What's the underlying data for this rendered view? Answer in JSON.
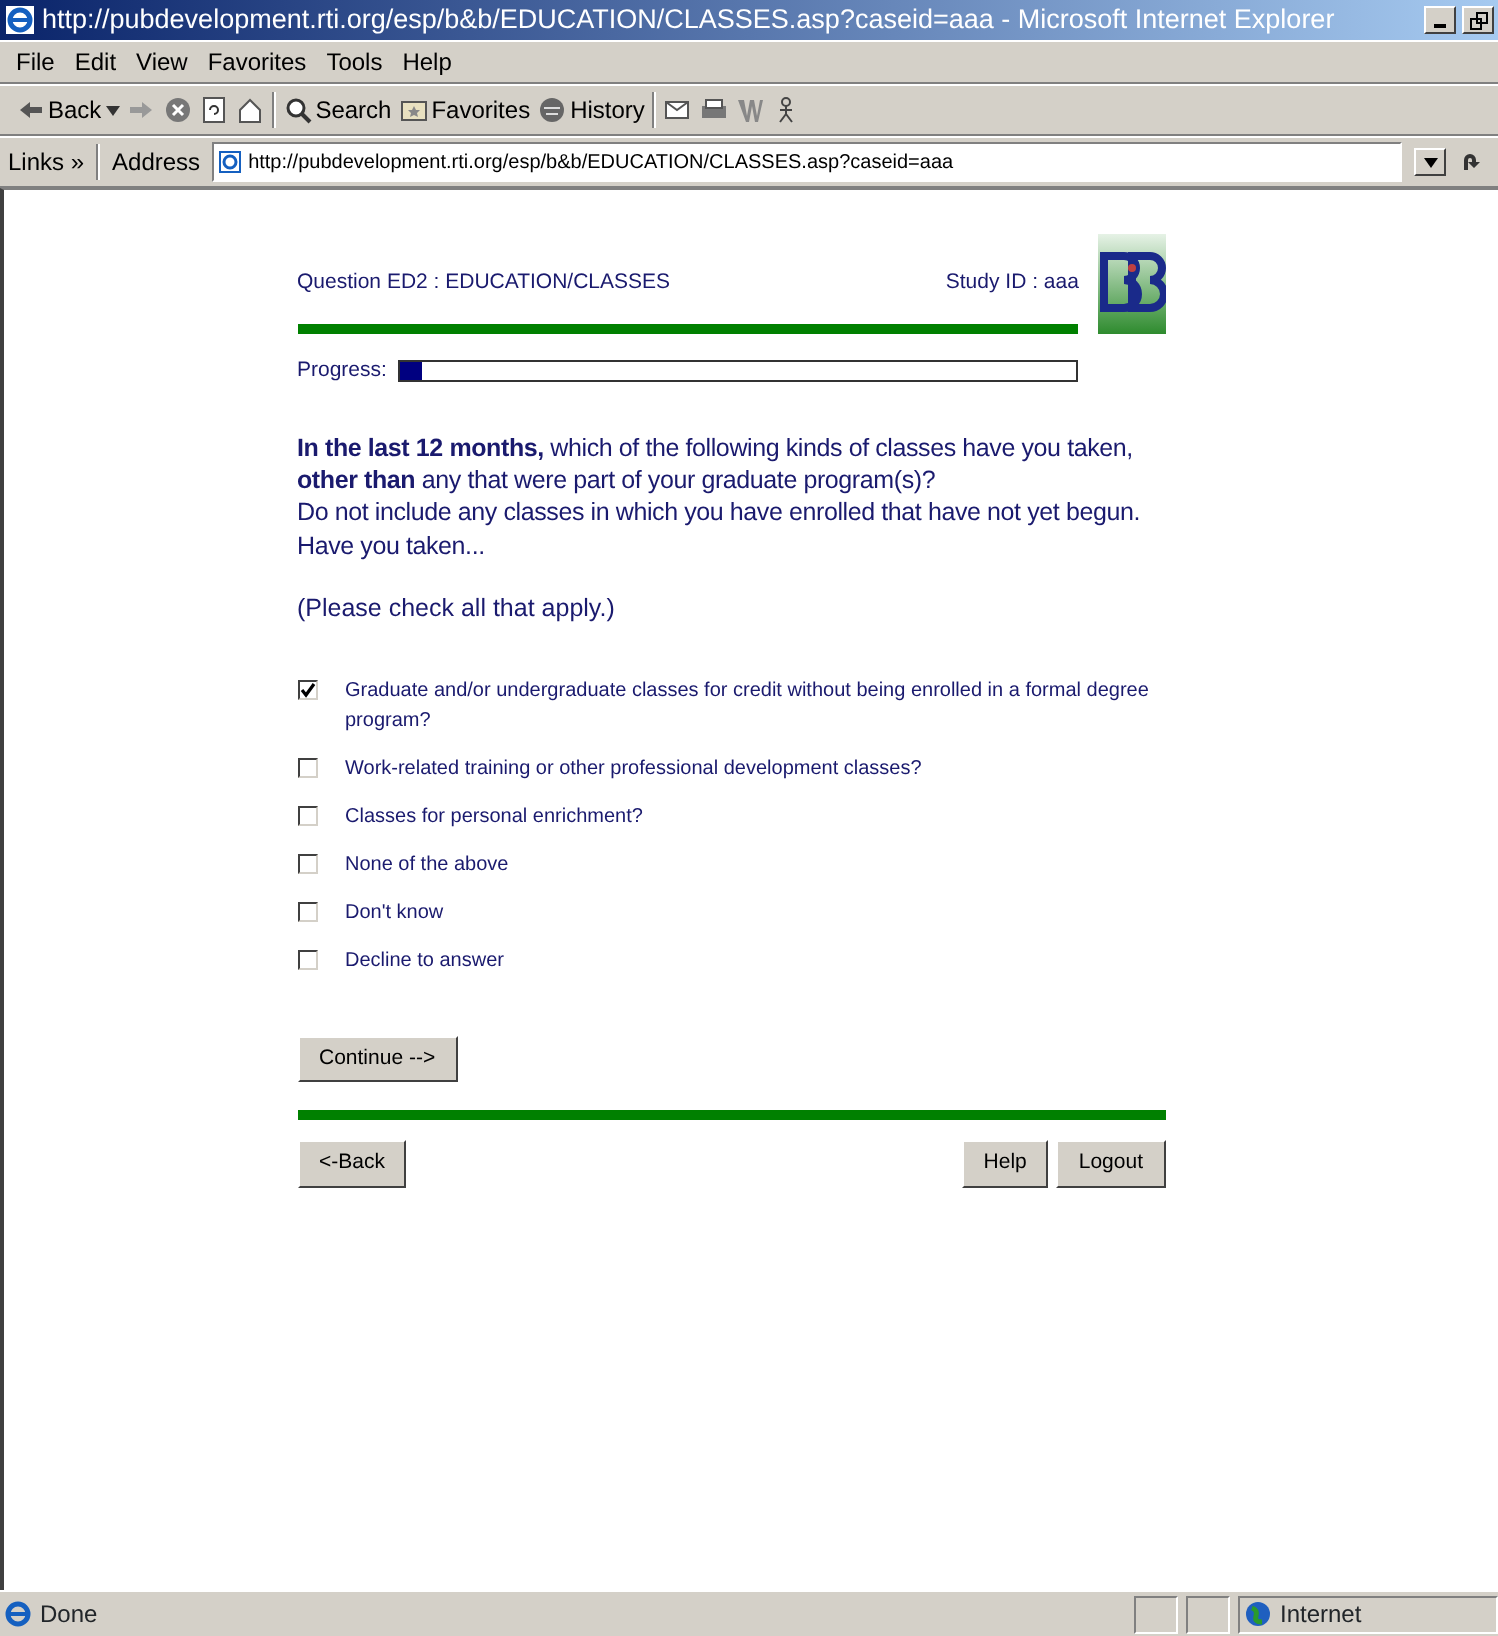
{
  "window": {
    "title": "http://pubdevelopment.rti.org/esp/b&b/EDUCATION/CLASSES.asp?caseid=aaa - Microsoft Internet Explorer"
  },
  "menu": [
    "File",
    "Edit",
    "View",
    "Favorites",
    "Tools",
    "Help"
  ],
  "toolbar": [
    {
      "kind": "back",
      "label": "Back"
    },
    {
      "kind": "forward"
    },
    {
      "kind": "stop"
    },
    {
      "kind": "refresh"
    },
    {
      "kind": "home"
    },
    {
      "kind": "search",
      "label": "Search"
    },
    {
      "kind": "favorites",
      "label": "Favorites"
    },
    {
      "kind": "history",
      "label": "History"
    },
    {
      "kind": "mail"
    },
    {
      "kind": "print"
    },
    {
      "kind": "edit"
    },
    {
      "kind": "messenger"
    }
  ],
  "address_bar": {
    "links": "Links",
    "chevron": "»",
    "label": "Address",
    "url": "http://pubdevelopment.rti.org/esp/b&b/EDUCATION/CLASSES.asp?caseid=aaa"
  },
  "survey": {
    "question_id": "Question ED2 : EDUCATION/CLASSES",
    "study_id": "Study ID : aaa",
    "progress": {
      "label": "Progress:",
      "level": 0.03
    },
    "question": "**In the last 12 months,** which of the following kinds of classes have you taken, **other than** any that were part of your graduate program(s)?",
    "instruction": "Do not include any classes in which you have enrolled that have not yet begun.",
    "lead_in": "Have you taken...",
    "hint": "(Please check all that apply.)",
    "options": [
      {
        "label": "Graduate and/or undergraduate classes for credit without being enrolled in a formal degree program?",
        "checked": true
      },
      {
        "label": "Work-related training or other professional development classes?",
        "checked": false
      },
      {
        "label": "Classes for personal enrichment?",
        "checked": false
      },
      {
        "label": "None of the above",
        "checked": false
      },
      {
        "label": "Don't know",
        "checked": false
      },
      {
        "label": "Decline to answer",
        "checked": false
      }
    ],
    "continue_button": "Continue -->",
    "back_button": "<-Back",
    "help_button": "Help",
    "logout_button": "Logout"
  },
  "status_bar": {
    "text": "Done",
    "zone": "Internet"
  }
}
